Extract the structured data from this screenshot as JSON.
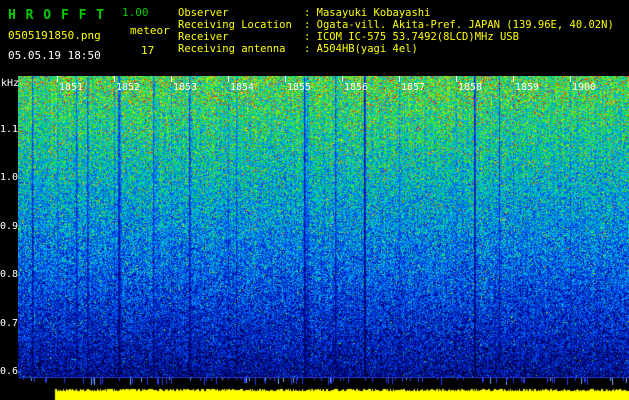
{
  "header": {
    "app_name": "H R O F F T",
    "version": "1.00",
    "filename": "0505191850.png",
    "mode": "meteor",
    "datetime": "05.05.19 18:50",
    "count": "17",
    "separator": ": ",
    "info": [
      {
        "label": "Observer",
        "value": "Masayuki Kobayashi"
      },
      {
        "label": "Receiving Location",
        "value": "Ogata-vill. Akita-Pref. JAPAN (139.96E, 40.02N)"
      },
      {
        "label": "Receiver",
        "value": "ICOM IC-575 53.7492(8LCD)MHz USB"
      },
      {
        "label": "Receiving antenna",
        "value": "A504HB(yagi 4el)"
      }
    ]
  },
  "chart_data": {
    "type": "heatmap",
    "subtype": "radio-meteor-spectrogram",
    "x_axis": {
      "tick_labels": [
        "1851",
        "1852",
        "1853",
        "1854",
        "1855",
        "1856",
        "1857",
        "1858",
        "1859",
        "1900"
      ],
      "start": "1850",
      "end": "1900",
      "minutes_per_division": 1
    },
    "y_axis": {
      "label": "kHz",
      "tick_labels": [
        "1.1",
        "1.0",
        "0.9",
        "0.8",
        "0.7",
        "0.6"
      ],
      "range": [
        0.55,
        1.2
      ]
    },
    "grid": false,
    "legend": "none",
    "content": "broadband noise spectrogram; intensity high near 1.1-1.2 kHz (green field with yellow/orange/red speckle, densest red in top band) fading through cyan/blue to dark navy speckle near 0.6 kHz; sparse dark vertical dropout lines; blue tick row and solid yellow signal-level bar along bottom edge",
    "level_bar": {
      "color": "#ffff00"
    }
  },
  "colors": {
    "green": "#00cc00",
    "yellow": "#ffff00",
    "white": "#ffffff",
    "tick_blue": "#2a3cff",
    "level_bar": "#ffff00"
  }
}
